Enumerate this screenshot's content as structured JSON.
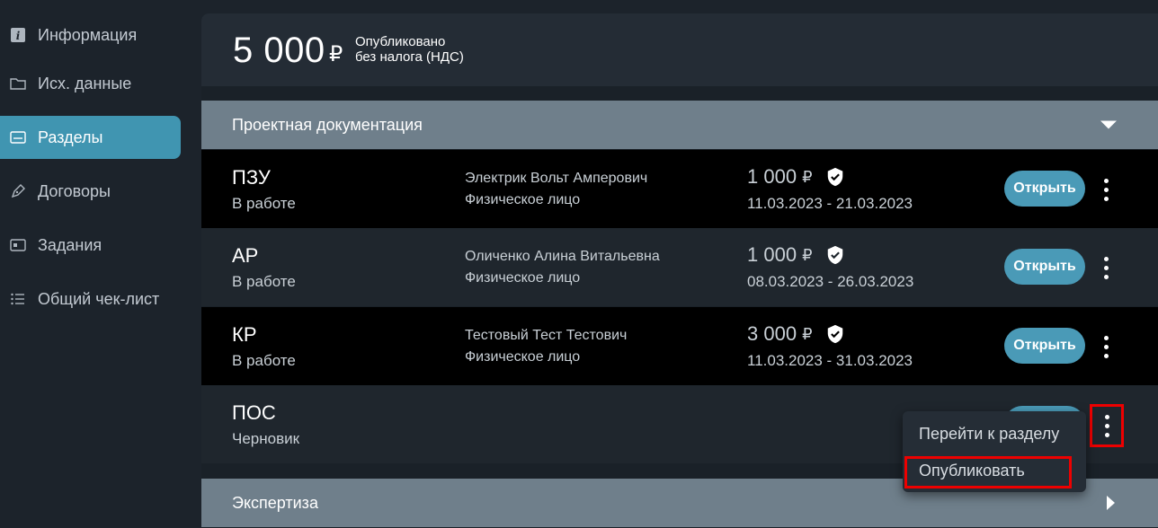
{
  "sidebar": {
    "items": [
      {
        "label": "Информация",
        "icon": "info-icon"
      },
      {
        "label": "Исх. данные",
        "icon": "folder-icon"
      },
      {
        "label": "Разделы",
        "icon": "sections-icon",
        "active": true
      },
      {
        "label": "Договоры",
        "icon": "pen-icon"
      },
      {
        "label": "Задания",
        "icon": "tasks-icon"
      },
      {
        "label": "Общий чек-лист",
        "icon": "list-icon"
      }
    ]
  },
  "summary": {
    "amount": "5 000",
    "currency": "₽",
    "status_line1": "Опубликовано",
    "status_line2": "без налога (НДС)"
  },
  "groups": [
    {
      "title": "Проектная документация",
      "expanded": true
    },
    {
      "title": "Экспертиза",
      "expanded": false
    }
  ],
  "rows": [
    {
      "name": "ПЗУ",
      "status": "В работе",
      "person": "Электрик Вольт Амперович",
      "person_type": "Физическое лицо",
      "price": "1 000",
      "currency": "₽",
      "dates": "11.03.2023 - 21.03.2023",
      "open_label": "Открыть"
    },
    {
      "name": "АР",
      "status": "В работе",
      "person": "Оличенко Алина Витальевна",
      "person_type": "Физическое лицо",
      "price": "1 000",
      "currency": "₽",
      "dates": "08.03.2023 - 26.03.2023",
      "open_label": "Открыть"
    },
    {
      "name": "КР",
      "status": "В работе",
      "person": "Тестовый Тест Тестович",
      "person_type": "Физическое лицо",
      "price": "3 000",
      "currency": "₽",
      "dates": "11.03.2023 - 31.03.2023",
      "open_label": "Открыть"
    },
    {
      "name": "ПОС",
      "status": "Черновик"
    }
  ],
  "context_menu": {
    "items": [
      {
        "label": "Перейти к разделу"
      },
      {
        "label": "Опубликовать"
      }
    ]
  },
  "colors": {
    "accent": "#4a9ab7",
    "active_nav": "#4095b1",
    "group_header": "#6f7f8b",
    "highlight": "#e00000"
  }
}
